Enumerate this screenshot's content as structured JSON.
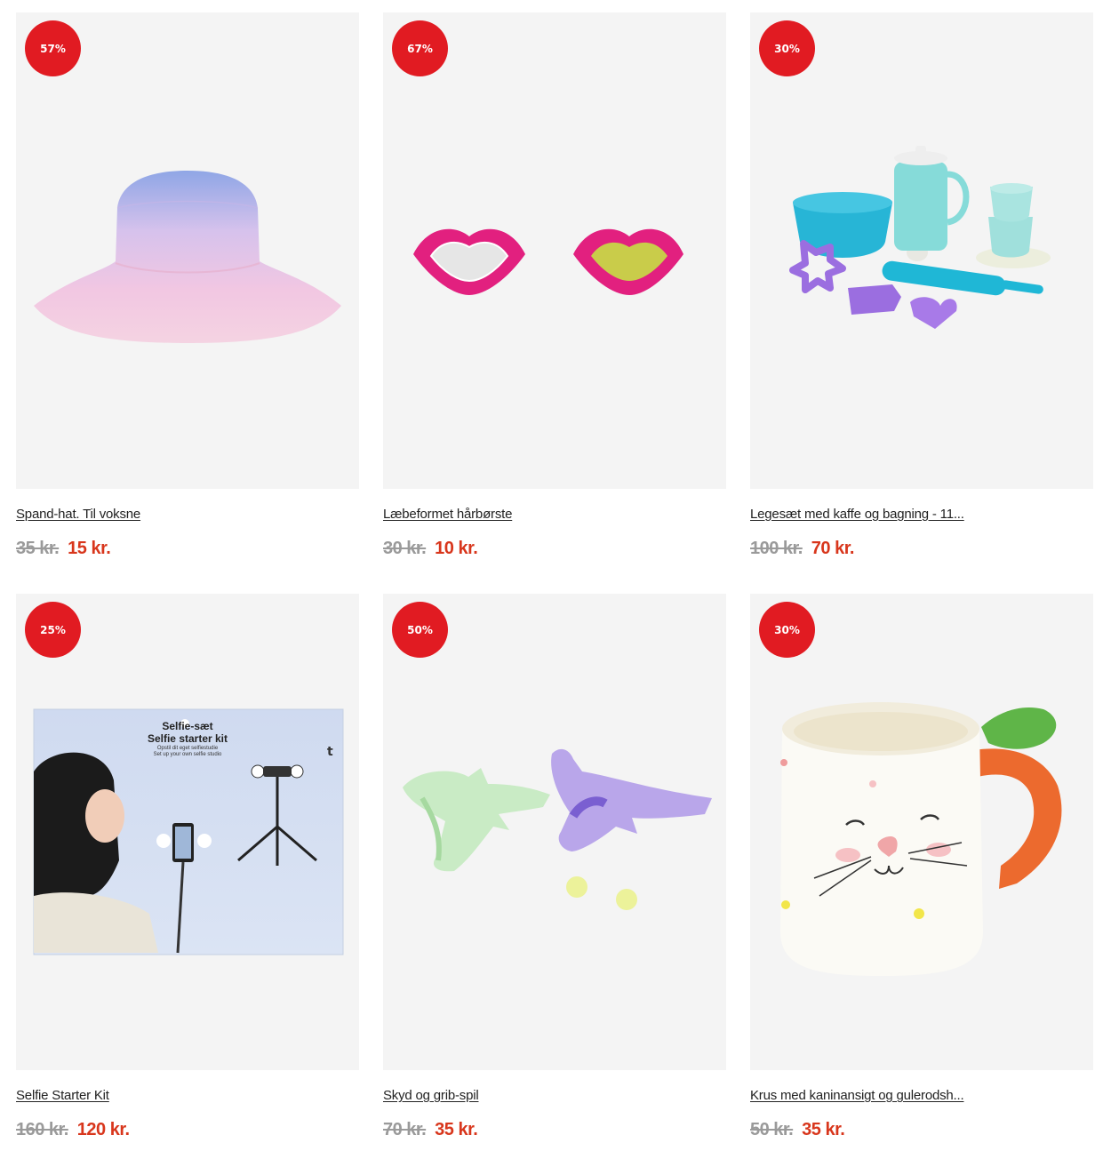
{
  "products": [
    {
      "badge": "57%",
      "name": "Spand-hat. Til voksne",
      "old_price": "35 kr.",
      "new_price": "15 kr.",
      "image": "bucket-hat"
    },
    {
      "badge": "67%",
      "name": "Læbeformet hårbørste",
      "old_price": "30 kr.",
      "new_price": "10 kr.",
      "image": "lip-brushes"
    },
    {
      "badge": "30%",
      "name": "Legesæt med kaffe og bagning - 11...",
      "old_price": "100 kr.",
      "new_price": "70 kr.",
      "image": "play-kitchen-set"
    },
    {
      "badge": "25%",
      "name": "Selfie Starter Kit",
      "old_price": "160 kr.",
      "new_price": "120 kr.",
      "image": "selfie-kit",
      "box_text": {
        "title1": "Selfie-sæt",
        "title2": "Selfie starter kit",
        "sub1": "Opstil dit eget selfiestudie",
        "sub2": "Set up your own selfie studio"
      }
    },
    {
      "badge": "50%",
      "name": "Skyd og grib-spil",
      "old_price": "70 kr.",
      "new_price": "35 kr.",
      "image": "shark-grabbers"
    },
    {
      "badge": "30%",
      "name": "Krus med kaninansigt og gulerodsh...",
      "old_price": "50 kr.",
      "new_price": "35 kr.",
      "image": "bunny-mug"
    }
  ],
  "colors": {
    "badge": "#e11b22",
    "sale_price": "#d8361c",
    "old_price": "#9a9a9a",
    "card_bg": "#f4f4f4"
  }
}
